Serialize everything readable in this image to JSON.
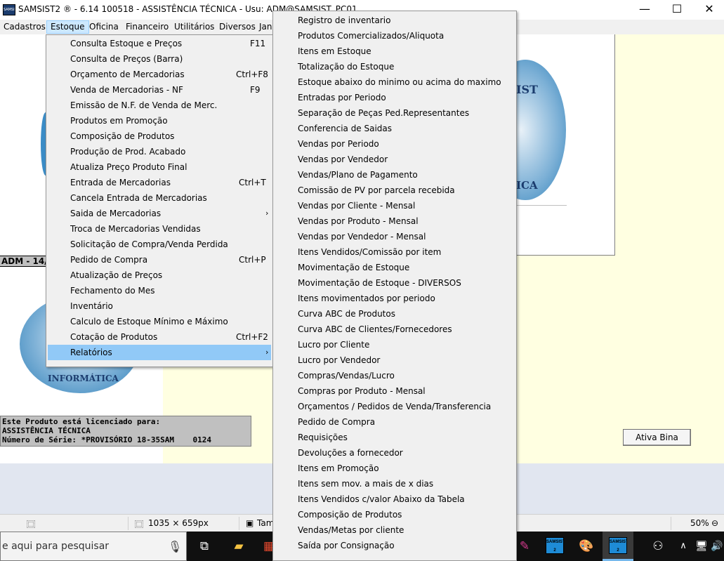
{
  "window": {
    "title": "SAMSIST2 ® - 6.14  100518 - ASSISTÊNCIA TÉCNICA - Usu: ADM@SAMSIST_PC01",
    "minimize": "—",
    "maximize": "☐",
    "close": "✕"
  },
  "menubar": [
    "Cadastros",
    "Estoque",
    "Oficina",
    "Financeiro",
    "Utilitários",
    "Diversos",
    "Jan"
  ],
  "estoque_menu": [
    {
      "label": "Consulta Estoque e Preços",
      "shortcut": "F11"
    },
    {
      "label": "Consulta de Preços (Barra)",
      "shortcut": ""
    },
    {
      "label": "Orçamento de Mercadorias",
      "shortcut": "Ctrl+F8"
    },
    {
      "label": "Venda de Mercadorias - NF",
      "shortcut": "F9"
    },
    {
      "label": "Emissão de N.F. de Venda de Merc.",
      "shortcut": ""
    },
    {
      "label": "Produtos em Promoção",
      "shortcut": ""
    },
    {
      "label": "Composição de Produtos",
      "shortcut": ""
    },
    {
      "label": "Produção de Prod. Acabado",
      "shortcut": ""
    },
    {
      "label": "Atualiza Preço Produto Final",
      "shortcut": ""
    },
    {
      "label": "Entrada de Mercadorias",
      "shortcut": "Ctrl+T"
    },
    {
      "label": "Cancela Entrada de Mercadorias",
      "shortcut": ""
    },
    {
      "label": "Saida de Mercadorias",
      "shortcut": "",
      "submenu": true
    },
    {
      "label": "Troca de Mercadorias Vendidas",
      "shortcut": ""
    },
    {
      "label": "Solicitação de Compra/Venda Perdida",
      "shortcut": ""
    },
    {
      "label": "Pedido de Compra",
      "shortcut": "Ctrl+P"
    },
    {
      "label": "Atualização de Preços",
      "shortcut": ""
    },
    {
      "label": "Fechamento do Mes",
      "shortcut": ""
    },
    {
      "label": "Inventário",
      "shortcut": ""
    },
    {
      "label": "Calculo de Estoque Mínimo e Máximo",
      "shortcut": ""
    },
    {
      "label": "Cotação de Produtos",
      "shortcut": "Ctrl+F2"
    },
    {
      "label": "Relatórios",
      "shortcut": "",
      "submenu": true,
      "highlighted": true
    }
  ],
  "submenu_arrow": "›",
  "relatorios_menu": [
    "Registro de inventario",
    "Produtos Comercializados/Aliquota",
    "Itens em Estoque",
    "Totalização do Estoque",
    "Estoque abaixo do minimo ou acima do maximo",
    "Entradas por Periodo",
    "Separação de Peças Ped.Representantes",
    "Conferencia de Saidas",
    "Vendas por Periodo",
    "Vendas por Vendedor",
    "Vendas/Plano de Pagamento",
    "Comissão de PV por parcela recebida",
    "Vendas por Cliente - Mensal",
    "Vendas por Produto - Mensal",
    "Vendas por Vendedor - Mensal",
    "Itens Vendidos/Comissão por item",
    "Movimentação de Estoque",
    "Movimentação de Estoque - DIVERSOS",
    "Itens movimentados por periodo",
    "Curva ABC de Produtos",
    "Curva ABC de Clientes/Fornecedores",
    "Lucro por Cliente",
    "Lucro por Vendedor",
    "Compras/Vendas/Lucro",
    "Compras por Produto - Mensal",
    "Orçamentos / Pedidos de Venda/Transferencia",
    "Pedido de Compra",
    "Requisições",
    "Devoluções a fornecedor",
    "Itens em Promoção",
    "Itens sem mov. a mais de x dias",
    "Itens Vendidos c/valor Abaixo da Tabela",
    "Composição de Produtos",
    "Vendas/Metas por cliente",
    "Saída por Consignação"
  ],
  "main": {
    "logo_text_top": "IST",
    "logo_text_bottom": "ICA",
    "logo_small_text": "INFORMÁTICA",
    "adm_strip": "ADM - 14/",
    "license_lines": [
      "Este Produto está licenciado para:",
      "ASSISTÊNCIA TÉCNICA",
      "Número de Série: *PROVISÓRIO 18-35SAM    0124"
    ],
    "ativa_bina": "Ativa Bina"
  },
  "statusbar": {
    "dimensions": "1035 × 659px",
    "size_label": "Tam",
    "zoom": "50%"
  },
  "taskbar": {
    "search_placeholder": "e aqui para pesquisar",
    "app_label": "SAMSIST 2"
  }
}
